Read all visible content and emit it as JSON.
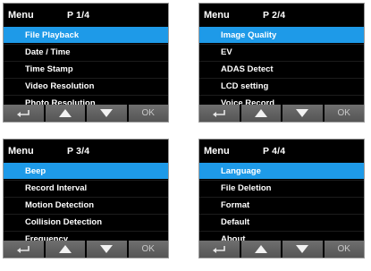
{
  "panels": [
    {
      "menu_label": "Menu",
      "page_label": "P 1/4",
      "items": [
        {
          "label": "File Playback",
          "selected": true
        },
        {
          "label": "Date / Time",
          "selected": false
        },
        {
          "label": "Time Stamp",
          "selected": false
        },
        {
          "label": "Video Resolution",
          "selected": false
        },
        {
          "label": "Photo Resolution",
          "selected": false
        }
      ],
      "ok_label": "OK"
    },
    {
      "menu_label": "Menu",
      "page_label": "P 2/4",
      "items": [
        {
          "label": "Image Quality",
          "selected": true
        },
        {
          "label": "EV",
          "selected": false
        },
        {
          "label": "ADAS Detect",
          "selected": false
        },
        {
          "label": "LCD setting",
          "selected": false
        },
        {
          "label": "Voice Record",
          "selected": false
        }
      ],
      "ok_label": "OK"
    },
    {
      "menu_label": "Menu",
      "page_label": "P 3/4",
      "items": [
        {
          "label": "Beep",
          "selected": true
        },
        {
          "label": "Record Interval",
          "selected": false
        },
        {
          "label": "Motion Detection",
          "selected": false
        },
        {
          "label": "Collision Detection",
          "selected": false
        },
        {
          "label": "Frequency",
          "selected": false
        }
      ],
      "ok_label": "OK"
    },
    {
      "menu_label": "Menu",
      "page_label": "P 4/4",
      "items": [
        {
          "label": "Language",
          "selected": true
        },
        {
          "label": "File Deletion",
          "selected": false
        },
        {
          "label": "Format",
          "selected": false
        },
        {
          "label": "Default",
          "selected": false
        },
        {
          "label": "About",
          "selected": false
        }
      ],
      "ok_label": "OK"
    }
  ],
  "colors": {
    "highlight": "#1e9ae8",
    "background": "#000000",
    "text": "#ffffff",
    "button": "#666666"
  },
  "icons": [
    "back-icon",
    "up-arrow-icon",
    "down-arrow-icon"
  ]
}
